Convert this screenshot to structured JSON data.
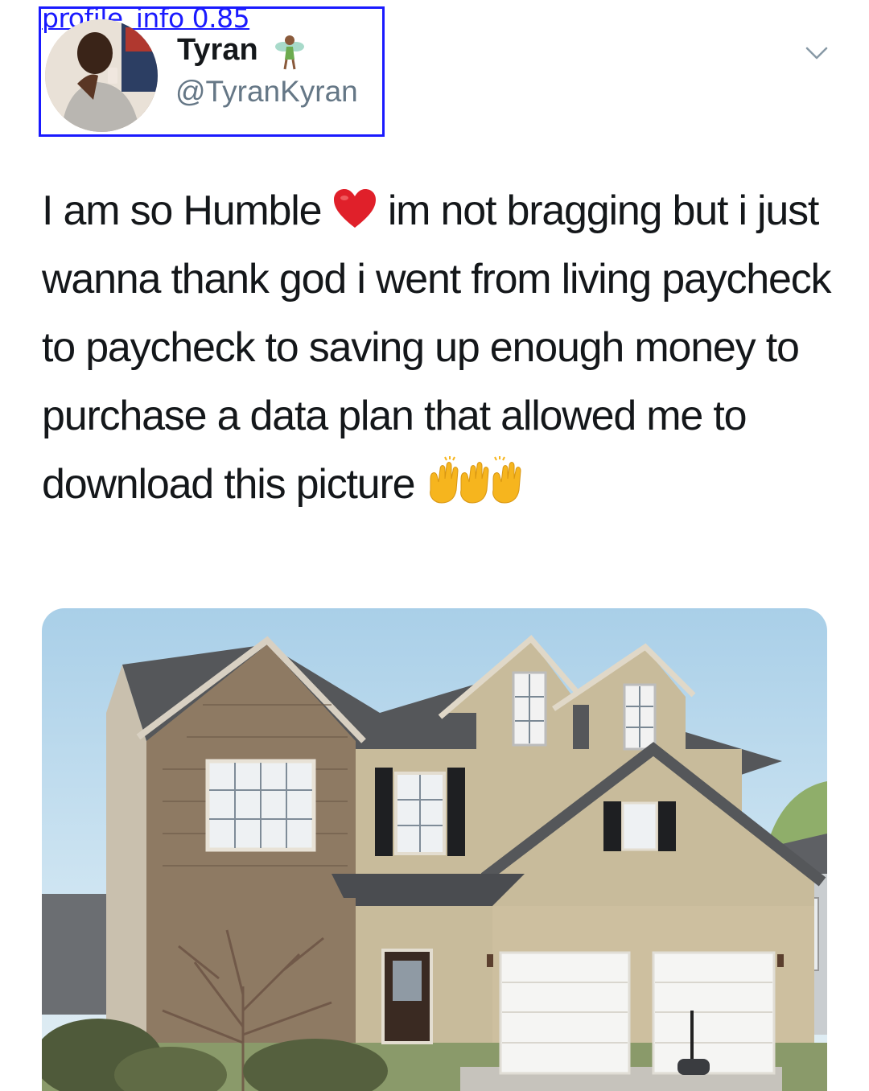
{
  "detection": {
    "label": "profile_info 0.85"
  },
  "tweet": {
    "author": {
      "display_name": "Tyran",
      "name_emoji": "fairy-emoji",
      "handle": "@TyranKyran",
      "avatar": "avatar-photo"
    },
    "text_part1": "I am so Humble ",
    "text_heart": "red-heart-emoji",
    "text_part2": " im not bragging but i just wanna thank god i went from living paycheck to paycheck to saving up enough money to purchase a data plan that allowed me to download this picture ",
    "text_end_emoji": "raising-hands-emoji",
    "media": {
      "description_icon": "house-photo"
    }
  },
  "colors": {
    "detection_box": "#1a1aff",
    "text": "#14171a",
    "handle": "#657786",
    "heart": "#e0202a",
    "hands": "#f6b51e"
  }
}
